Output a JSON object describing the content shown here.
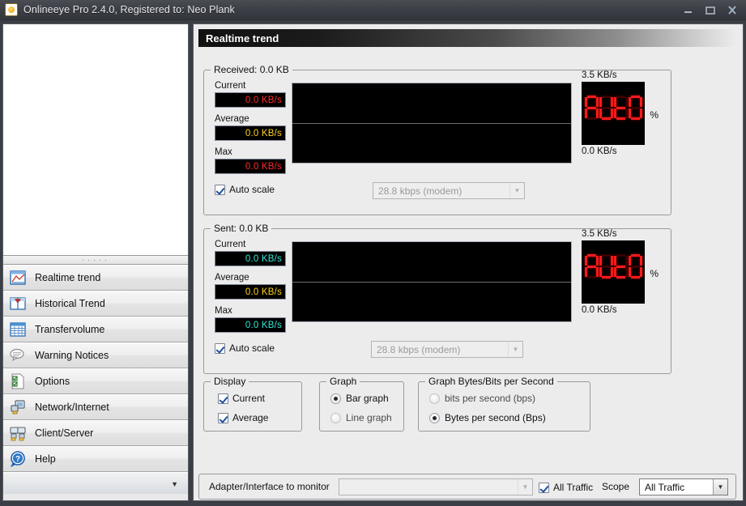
{
  "window": {
    "title": "Onlineeye Pro 2.4.0, Registered to: Neo Plank",
    "icon": "sun-app-icon",
    "controls": {
      "minimize": "minimize-icon",
      "maximize": "maximize-icon",
      "close": "close-icon"
    }
  },
  "sidebar": {
    "items": [
      {
        "label": "Realtime trend",
        "icon": "realtime-trend-icon"
      },
      {
        "label": "Historical Trend",
        "icon": "historical-trend-icon"
      },
      {
        "label": "Transfervolume",
        "icon": "transfervolume-icon"
      },
      {
        "label": "Warning Notices",
        "icon": "warning-notices-icon"
      },
      {
        "label": "Options",
        "icon": "options-icon"
      },
      {
        "label": "Network/Internet",
        "icon": "network-internet-icon"
      },
      {
        "label": "Client/Server",
        "icon": "client-server-icon"
      },
      {
        "label": "Help",
        "icon": "help-icon"
      }
    ],
    "scroll_chevron": "chevron-down-icon"
  },
  "panel": {
    "header": "Realtime trend"
  },
  "received": {
    "title": "Received: 0.0 KB",
    "meters": [
      {
        "label": "Current",
        "value": "0.0 KB/s",
        "color": "#ff2a2a"
      },
      {
        "label": "Average",
        "value": "0.0 KB/s",
        "color": "#ffd11a"
      },
      {
        "label": "Max",
        "value": "0.0 KB/s",
        "color": "#ff2a2a"
      }
    ],
    "scale_top": "3.5 KB/s",
    "scale_bottom": "0.0 KB/s",
    "led_text": "AUTO",
    "percent_symbol": "%",
    "auto_scale": {
      "label": "Auto scale",
      "checked": true
    },
    "speed_combo": {
      "value": "28.8 kbps (modem)",
      "enabled": false
    }
  },
  "sent": {
    "title": "Sent: 0.0 KB",
    "meters": [
      {
        "label": "Current",
        "value": "0.0 KB/s",
        "color": "#2ee6d6"
      },
      {
        "label": "Average",
        "value": "0.0 KB/s",
        "color": "#ffd11a"
      },
      {
        "label": "Max",
        "value": "0.0 KB/s",
        "color": "#2ee6d6"
      }
    ],
    "scale_top": "3.5 KB/s",
    "scale_bottom": "0.0 KB/s",
    "led_text": "AUTO",
    "percent_symbol": "%",
    "auto_scale": {
      "label": "Auto scale",
      "checked": true
    },
    "speed_combo": {
      "value": "28.8 kbps (modem)",
      "enabled": false
    }
  },
  "display_group": {
    "title": "Display",
    "current": {
      "label": "Current",
      "checked": true
    },
    "average": {
      "label": "Average",
      "checked": true
    }
  },
  "graph_group": {
    "title": "Graph",
    "bar": {
      "label": "Bar graph",
      "selected": true
    },
    "line": {
      "label": "Line graph",
      "selected": false
    }
  },
  "units_group": {
    "title": "Graph Bytes/Bits per Second",
    "bits": {
      "label": "bits per second (bps)",
      "selected": false
    },
    "bytes": {
      "label": "Bytes per second (Bps)",
      "selected": true
    }
  },
  "bottom_bar": {
    "adapter_label": "Adapter/Interface to monitor",
    "adapter_combo": {
      "value": "",
      "enabled": false
    },
    "all_traffic_checkbox": {
      "label": "All Traffic",
      "checked": true
    },
    "scope_label": "Scope",
    "scope_combo": {
      "value": "All Traffic",
      "enabled": true
    }
  },
  "chart_data": {
    "type": "line",
    "title": "Realtime trend",
    "charts": [
      {
        "name": "Received",
        "ylim": [
          0,
          3.5
        ],
        "yunit": "KB/s",
        "gridlines": 1,
        "values": [],
        "background": "#000000"
      },
      {
        "name": "Sent",
        "ylim": [
          0,
          3.5
        ],
        "yunit": "KB/s",
        "gridlines": 1,
        "values": [],
        "background": "#000000"
      }
    ]
  }
}
